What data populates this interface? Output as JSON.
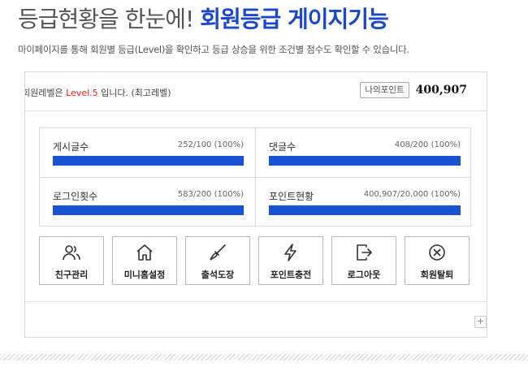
{
  "hero": {
    "title_light": "등급현황을 한눈에!",
    "title_strong": "회원등급 게이지기능",
    "subtitle": "마이페이지를 통해 회원별 등급(Level)을 확인하고 등급 상승을 위한 조건별 점수도 확인할 수 있습니다."
  },
  "panel": {
    "level_prefix": "회원레벨은",
    "level_value": "Level.5",
    "level_suffix": "입니다. (최고레벨)",
    "point_label": "나의포인트",
    "point_value": "400,907",
    "expand_label": "+"
  },
  "stats": [
    {
      "label": "게시글수",
      "value": "252/100 (100%)",
      "percent": 100
    },
    {
      "label": "댓글수",
      "value": "408/200 (100%)",
      "percent": 100
    },
    {
      "label": "로그인횟수",
      "value": "583/200 (100%)",
      "percent": 100
    },
    {
      "label": "포인트현황",
      "value": "400,907/20,000 (100%)",
      "percent": 100
    }
  ],
  "actions": [
    {
      "label": "친구관리",
      "icon": "friends-icon"
    },
    {
      "label": "미니홈설정",
      "icon": "home-icon"
    },
    {
      "label": "출석도장",
      "icon": "stamp-icon"
    },
    {
      "label": "포인트충전",
      "icon": "lightning-icon"
    },
    {
      "label": "로그아웃",
      "icon": "logout-icon"
    },
    {
      "label": "회원탈퇴",
      "icon": "withdraw-icon"
    }
  ],
  "colors": {
    "accent": "#1a52d4",
    "title_blue": "#1c47c8",
    "level_red": "#e0271c"
  }
}
